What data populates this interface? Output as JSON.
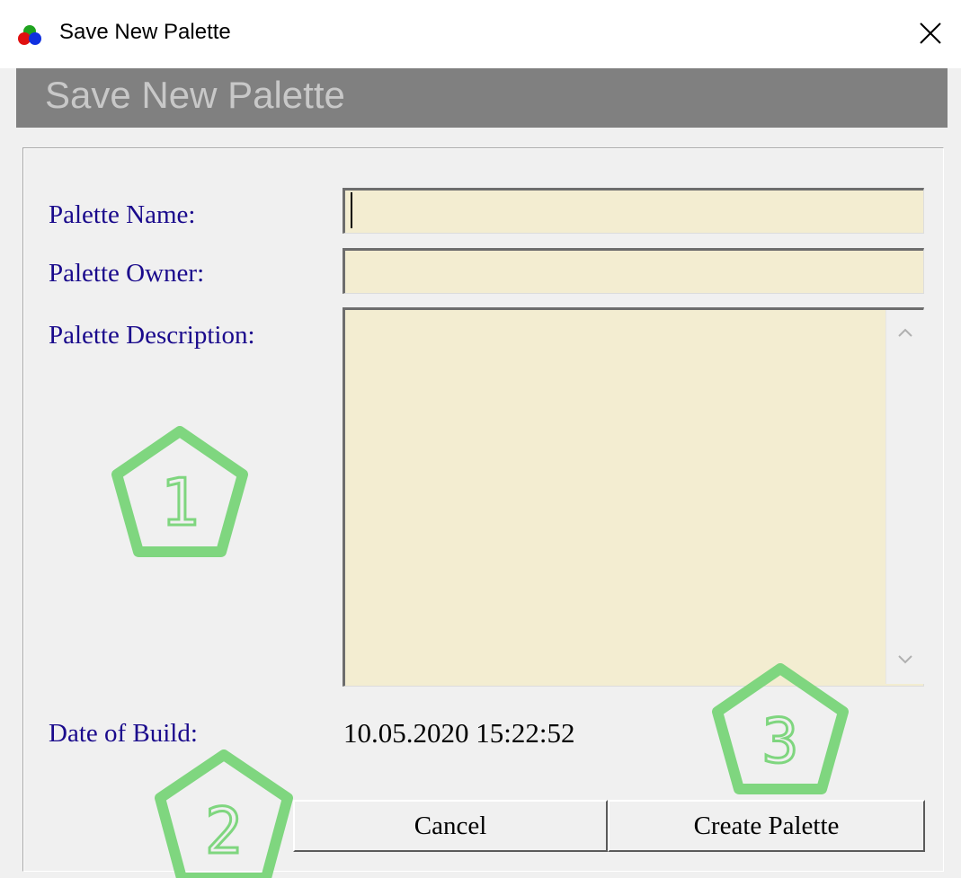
{
  "window": {
    "title": "Save New Palette",
    "icon": "rgb-circles-icon",
    "close_glyph": "✕"
  },
  "banner": {
    "title": "Save New Palette"
  },
  "form": {
    "palette_name": {
      "label": "Palette Name:",
      "value": ""
    },
    "palette_owner": {
      "label": "Palette Owner:",
      "value": ""
    },
    "palette_description": {
      "label": "Palette Description:",
      "value": ""
    },
    "date_of_build": {
      "label": "Date of Build:",
      "value": "10.05.2020 15:22:52"
    }
  },
  "buttons": {
    "cancel": "Cancel",
    "create": "Create Palette"
  },
  "annotations": [
    {
      "label": "1",
      "shape": "pentagon-outline"
    },
    {
      "label": "2",
      "shape": "pentagon-outline"
    },
    {
      "label": "3",
      "shape": "pentagon-outline"
    }
  ],
  "colors": {
    "label_text": "#1a0a8c",
    "field_background": "#f3edd1",
    "banner_background": "#808080",
    "annotation_green": "#7fd67f"
  }
}
